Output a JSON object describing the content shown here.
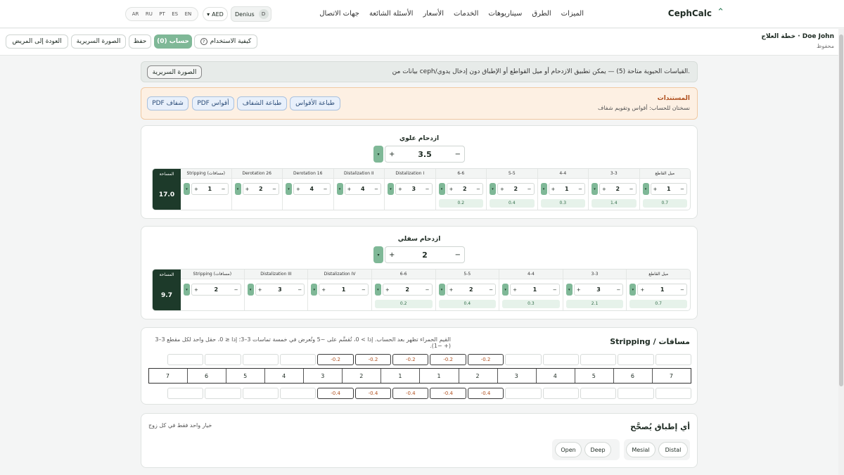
{
  "nav": {
    "brand": "CephCalc",
    "links": [
      "الميزات",
      "الطرق",
      "سيناريوهات",
      "الخدمات",
      "الأسعار",
      "الأسئلة الشائعة",
      "جهات الاتصال"
    ],
    "account": "Denius",
    "account_initial": "D",
    "currency": "AED",
    "languages": [
      "AR",
      "RU",
      "PT",
      "ES",
      "EN"
    ]
  },
  "subbar": {
    "plan_title": "خطة العلاج · Doe John",
    "plan_status": "محفوظ",
    "how_to": "كيفية الاستخدام",
    "calc": "حساب (0)",
    "save": "حفظ",
    "clinical_photo": "الصورة السريرية",
    "back": "العودة إلى المريض"
  },
  "info": {
    "text": "بيانات من ceph/القياسات الحيوية متاحة (5) — يمكن تطبيق الازدحام أو ميل القواطع أو الإطباق دون إدخال يدوي.",
    "button": "الصورة السريرية"
  },
  "documents": {
    "title": "المستندات",
    "subtitle": "نسختان للحساب: أقواس وتقويم شفاف",
    "buttons": [
      "طباعة الأقواس",
      "طباعة الشفاف",
      "PDF أقواس",
      "PDF شفاف"
    ]
  },
  "upper": {
    "label": "ازدحام علوي",
    "value": "3.5",
    "summary_label": "المساحة",
    "summary_value": "17.0",
    "columns": [
      {
        "name": "ميل القاطع",
        "value": "1",
        "result": "0.7"
      },
      {
        "name": "3-3",
        "value": "2",
        "result": "1.4"
      },
      {
        "name": "4-4",
        "value": "1",
        "result": "0.3"
      },
      {
        "name": "5-5",
        "value": "2",
        "result": "0.4"
      },
      {
        "name": "6-6",
        "value": "2",
        "result": "0.2"
      },
      {
        "name": "Distalization I",
        "value": "3",
        "result": ""
      },
      {
        "name": "Distalization II",
        "value": "4",
        "result": ""
      },
      {
        "name": "Derotation 16",
        "value": "4",
        "result": ""
      },
      {
        "name": "Derotation 26",
        "value": "2",
        "result": ""
      },
      {
        "name": "Stripping (مسافات)",
        "value": "1",
        "result": ""
      }
    ]
  },
  "lower": {
    "label": "ازدحام سفلي",
    "value": "2",
    "summary_label": "المساحة",
    "summary_value": "9.7",
    "columns": [
      {
        "name": "ميل القاطع",
        "value": "1",
        "result": "0.7"
      },
      {
        "name": "3-3",
        "value": "3",
        "result": "2.1"
      },
      {
        "name": "4-4",
        "value": "1",
        "result": "0.3"
      },
      {
        "name": "5-5",
        "value": "2",
        "result": "0.4"
      },
      {
        "name": "6-6",
        "value": "2",
        "result": "0.2"
      },
      {
        "name": "Distalization IV",
        "value": "1",
        "result": ""
      },
      {
        "name": "Distalization III",
        "value": "3",
        "result": ""
      },
      {
        "name": "Stripping (مسافات)",
        "value": "2",
        "result": ""
      }
    ]
  },
  "stripping": {
    "title": "Stripping / مسافات",
    "note": "القيم الحمراء تظهر بعد الحساب. إذا > 0، تُقسَّم على ~5 وتُعرض في خمسة تماسات 3–3؛ إذا ≤ 0، حقل واحد لكل مقطع 3–3 (+ −1).",
    "top_cells": [
      "",
      "",
      "",
      "",
      "",
      "-0.2",
      "-0.2",
      "-0.2",
      "-0.2",
      "-0.2",
      "",
      "",
      "",
      ""
    ],
    "teeth": [
      "7",
      "6",
      "5",
      "4",
      "3",
      "2",
      "1",
      "1",
      "2",
      "3",
      "4",
      "5",
      "6",
      "7"
    ],
    "bottom_cells": [
      "",
      "",
      "",
      "",
      "",
      "-0.4",
      "-0.4",
      "-0.4",
      "-0.4",
      "-0.4",
      "",
      "",
      "",
      ""
    ]
  },
  "occlusion": {
    "title": "أي إطباق يُصحَّح",
    "note": "خيار واحد فقط في كل زوج",
    "options": [
      "Distal",
      "Mesial",
      "Deep",
      "Open"
    ]
  }
}
